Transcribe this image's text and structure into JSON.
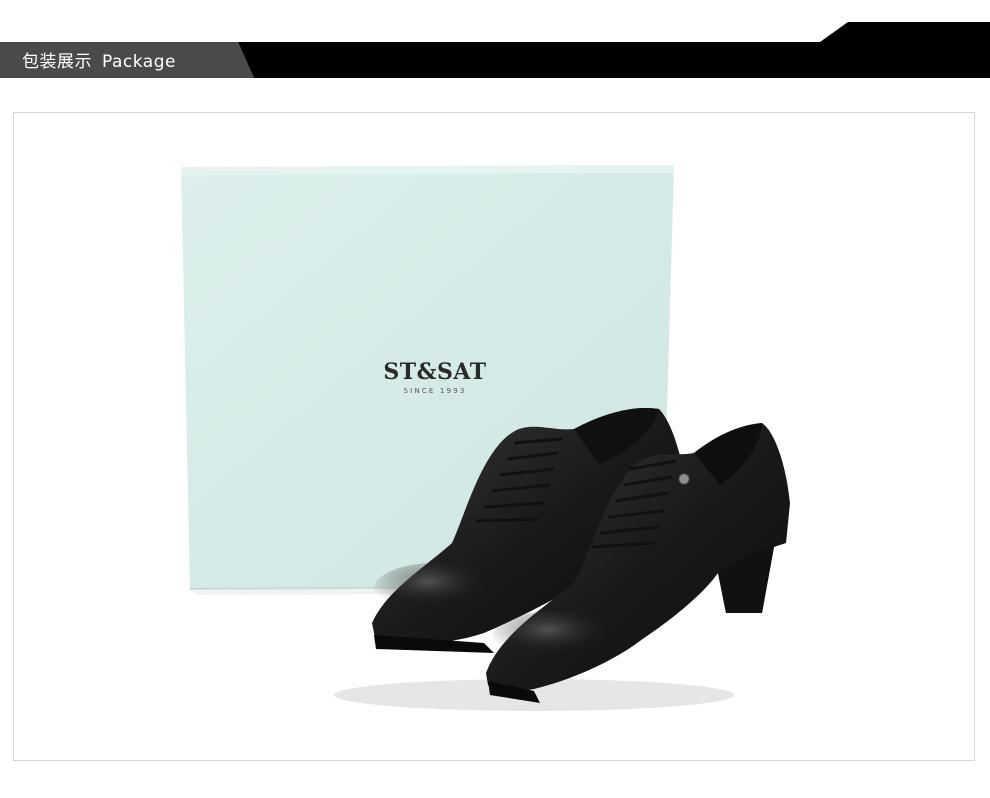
{
  "header": {
    "title_cn": "包装展示",
    "title_en": "Package",
    "bar_color": "#000000",
    "accent_color": "#4a4a4a"
  },
  "photo": {
    "box": {
      "brand": "ST&SAT",
      "tagline": "SINCE 1993",
      "color": "#d8ebe8"
    },
    "shoes": {
      "color": "#1b1b1b"
    }
  }
}
